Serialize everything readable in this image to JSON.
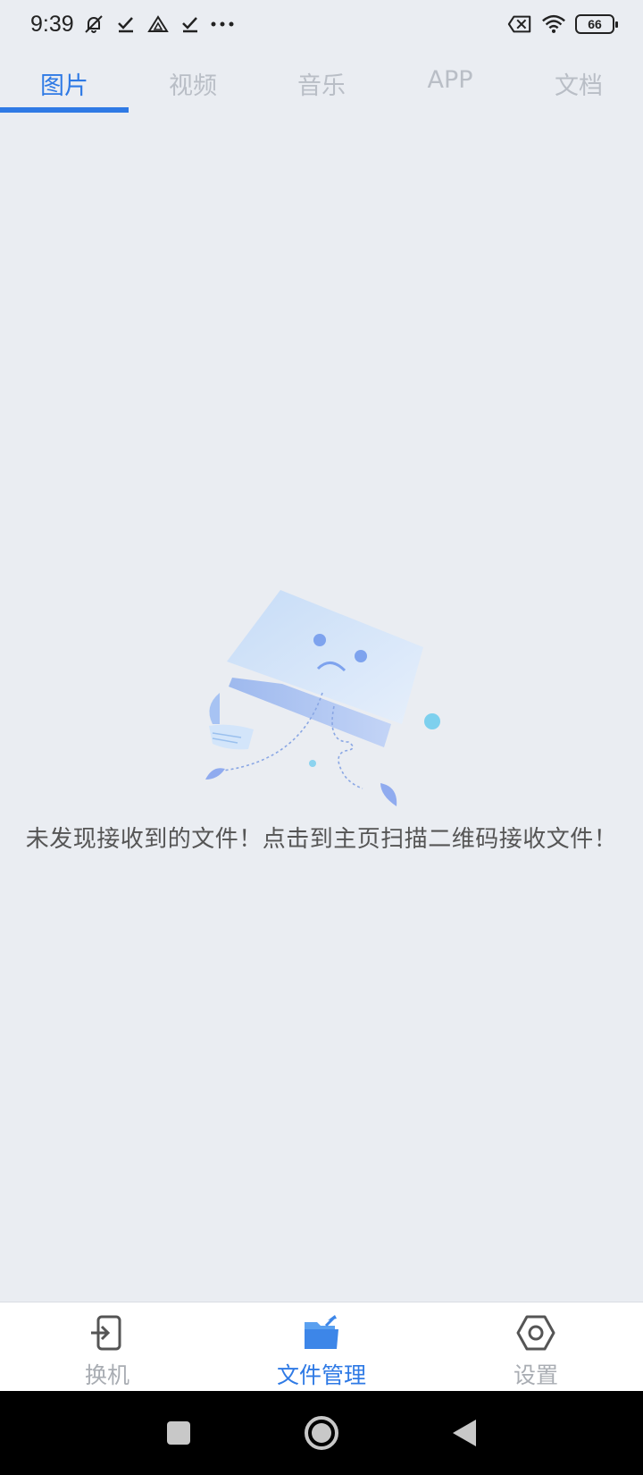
{
  "status_bar": {
    "time": "9:39",
    "battery": "66",
    "icons": [
      "mute-icon",
      "check-icon",
      "drive-icon",
      "check-icon",
      "more-dots-icon",
      "sim-off-icon",
      "wifi-icon",
      "battery-icon"
    ]
  },
  "tabs": [
    {
      "label": "图片",
      "active": true
    },
    {
      "label": "视频",
      "active": false
    },
    {
      "label": "音乐",
      "active": false
    },
    {
      "label": "APP",
      "active": false
    },
    {
      "label": "文档",
      "active": false
    }
  ],
  "empty_state": {
    "message": "未发现接收到的文件！点击到主页扫描二维码接收文件！",
    "illustration": "sad-folder-illustration"
  },
  "bottom_nav": [
    {
      "label": "换机",
      "icon": "phone-transfer-icon",
      "active": false
    },
    {
      "label": "文件管理",
      "icon": "folder-icon",
      "active": true
    },
    {
      "label": "设置",
      "icon": "settings-hex-icon",
      "active": false
    }
  ],
  "system_nav": {
    "icons": [
      "recent-apps-icon",
      "home-icon",
      "back-icon"
    ]
  },
  "colors": {
    "accent": "#2f7ae5",
    "background": "#eaedf2",
    "inactive_tab": "#b9bec6",
    "inactive_nav": "#a9adb3"
  }
}
